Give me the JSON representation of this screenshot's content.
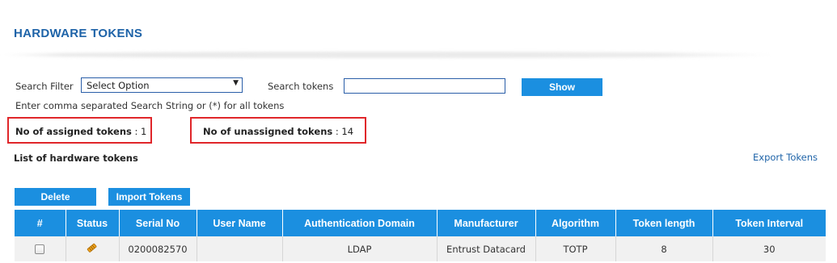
{
  "page": {
    "title": "HARDWARE TOKENS"
  },
  "filter": {
    "search_filter_label": "Search Filter",
    "select_value": "Select Option",
    "search_tokens_label": "Search tokens",
    "search_value": "",
    "show_button": "Show",
    "hint": "Enter comma separated Search String or (*) for all tokens"
  },
  "counts": {
    "assigned_label": "No of assigned tokens",
    "assigned_value": ": 1",
    "unassigned_label": "No of unassigned tokens",
    "unassigned_value": ": 14"
  },
  "list": {
    "heading": "List of hardware tokens",
    "export_link": "Export Tokens",
    "delete_button": "Delete",
    "import_button": "Import Tokens"
  },
  "table": {
    "columns": [
      "#",
      "Status",
      "Serial No",
      "User Name",
      "Authentication Domain",
      "Manufacturer",
      "Algorithm",
      "Token length",
      "Token Interval"
    ],
    "rows": [
      {
        "serial": "0200082570",
        "user": "",
        "domain": "LDAP",
        "manufacturer": "Entrust Datacard",
        "algorithm": "TOTP",
        "length": "8",
        "interval": "30",
        "status_icon": "pencil-tag-icon"
      }
    ]
  },
  "colors": {
    "accent": "#1b8fe0",
    "title": "#1e63a8",
    "highlight": "#e0262a"
  }
}
